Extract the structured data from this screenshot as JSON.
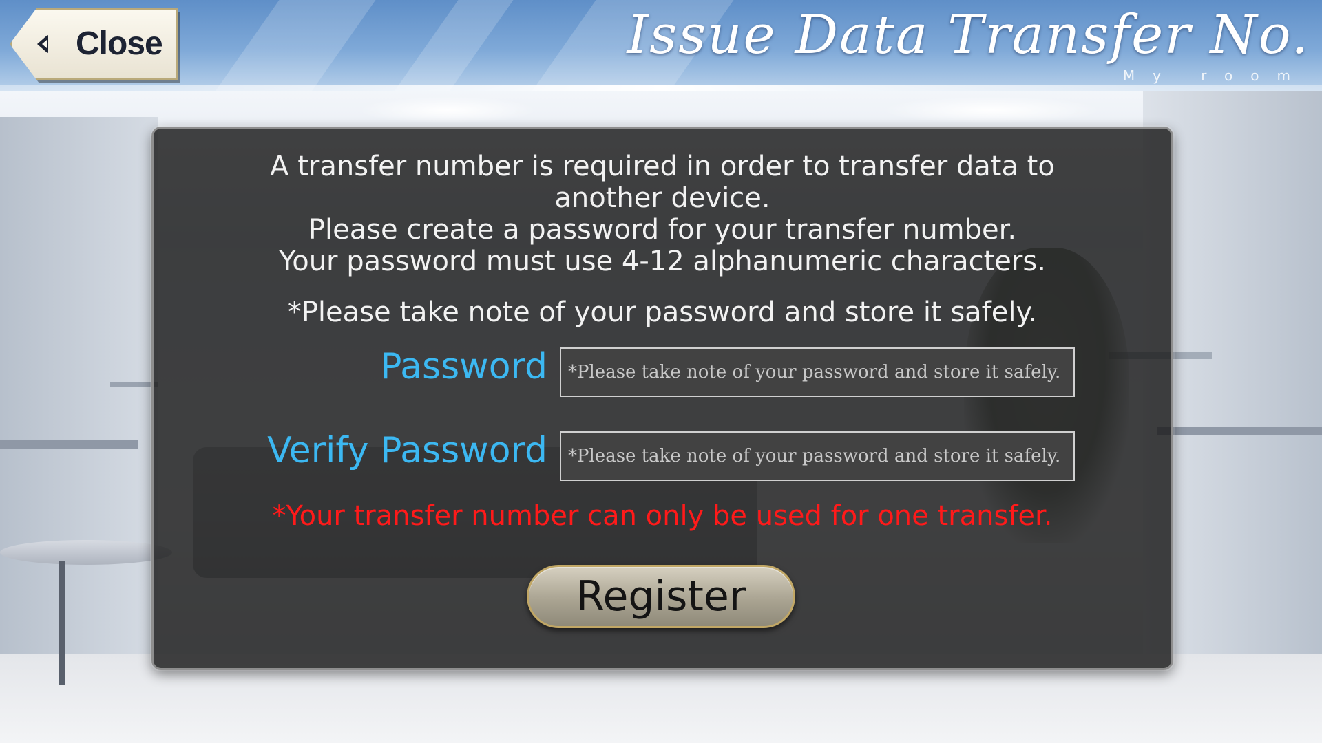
{
  "header": {
    "title": "Issue Data Transfer No.",
    "subtitle": "My room"
  },
  "close_button": {
    "label": "Close",
    "icon": "chevron-left-icon"
  },
  "dialog": {
    "intro_lines": [
      "A transfer number is required in order to transfer data to",
      "another device.",
      "Please create a password for your transfer number.",
      "Your password must use 4-12 alphanumeric characters."
    ],
    "note": "*Please take note of your password and store it safely.",
    "password": {
      "label": "Password",
      "value": "",
      "placeholder": "*Please take note of your password and store it safely."
    },
    "verify_password": {
      "label": "Verify Password",
      "value": "",
      "placeholder": "*Please take note of your password and store it safely."
    },
    "warning": "*Your transfer number can only be used for one transfer.",
    "register_label": "Register"
  },
  "colors": {
    "accent_label": "#3cb8f2",
    "warning": "#ff1a1a",
    "header_blue": "#5f8fc8"
  }
}
